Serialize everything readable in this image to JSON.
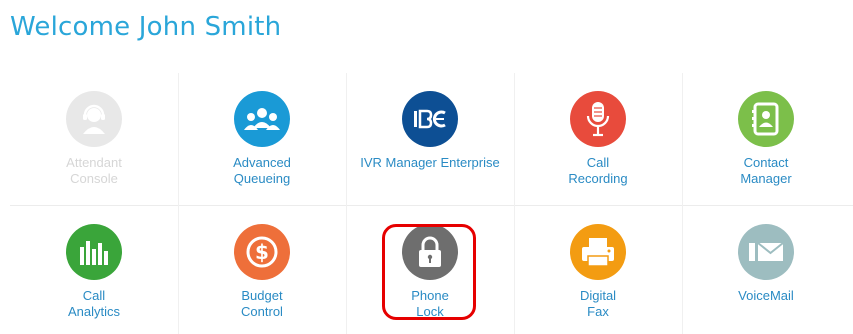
{
  "header": {
    "welcome": "Welcome John Smith"
  },
  "colors": {
    "title": "#2aa6d9",
    "label": "#2a8bc4",
    "highlight": "#e60000"
  },
  "tiles": [
    {
      "label": "Attendant\nConsole",
      "icon": "operator-headset-icon",
      "color": "#e8e8e8",
      "disabled": true
    },
    {
      "label": "Advanced\nQueueing",
      "icon": "group-users-icon",
      "color": "#1a9ad6",
      "disabled": false
    },
    {
      "label": "IVR Manager Enterprise",
      "icon": "ivr-icon",
      "color": "#0d4f94",
      "disabled": false
    },
    {
      "label": "Call\nRecording",
      "icon": "microphone-icon",
      "color": "#e84b3c",
      "disabled": false
    },
    {
      "label": "Contact\nManager",
      "icon": "contact-book-icon",
      "color": "#7cbf4a",
      "disabled": false
    },
    {
      "label": "Call\nAnalytics",
      "icon": "bar-chart-icon",
      "color": "#3aa53a",
      "disabled": false
    },
    {
      "label": "Budget\nControl",
      "icon": "dollar-icon",
      "color": "#ee6f3a",
      "disabled": false
    },
    {
      "label": "Phone\nLock",
      "icon": "lock-icon",
      "color": "#6e6e6e",
      "disabled": false
    },
    {
      "label": "Digital\nFax",
      "icon": "fax-icon",
      "color": "#f39c12",
      "disabled": false
    },
    {
      "label": "VoiceMail",
      "icon": "envelope-icon",
      "color": "#9dbdc0",
      "disabled": false
    }
  ]
}
